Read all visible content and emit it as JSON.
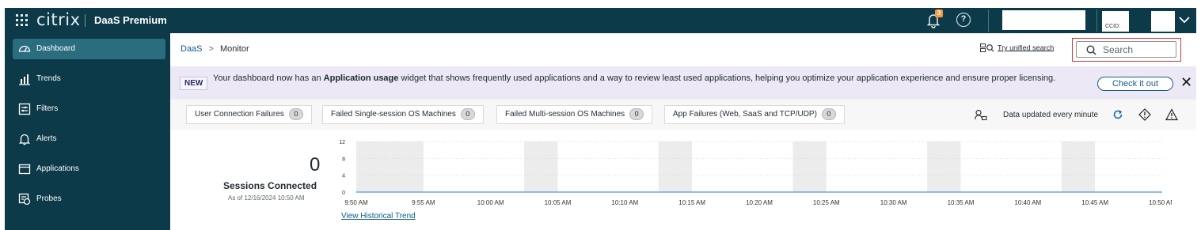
{
  "topbar": {
    "logo": "citrix",
    "product": "DaaS Premium",
    "notification_count": "3",
    "help_label": "?",
    "ccid_label": "CCID:"
  },
  "sidebar": {
    "items": [
      {
        "label": "Dashboard",
        "icon": "dashboard-icon",
        "active": true
      },
      {
        "label": "Trends",
        "icon": "trends-icon",
        "active": false
      },
      {
        "label": "Filters",
        "icon": "filters-icon",
        "active": false
      },
      {
        "label": "Alerts",
        "icon": "bell-icon",
        "active": false
      },
      {
        "label": "Applications",
        "icon": "applications-icon",
        "active": false
      },
      {
        "label": "Probes",
        "icon": "probes-icon",
        "active": false
      }
    ]
  },
  "breadcrumb": {
    "root": "DaaS",
    "separator": ">",
    "current": "Monitor"
  },
  "unified_search": {
    "label": "Try unified search"
  },
  "search": {
    "placeholder": "Search"
  },
  "banner": {
    "tag": "NEW",
    "text_before": "Your dashboard now has an ",
    "text_bold": "Application usage",
    "text_after": " widget that shows frequently used applications and a way to review least used applications, helping you optimize your application experience and ensure proper licensing.",
    "button": "Check it out",
    "close": "✕"
  },
  "chips": [
    {
      "label": "User Connection Failures",
      "count": "0"
    },
    {
      "label": "Failed Single-session OS Machines",
      "count": "0"
    },
    {
      "label": "Failed Multi-session OS Machines",
      "count": "0"
    },
    {
      "label": "App Failures (Web, SaaS and TCP/UDP)",
      "count": "0"
    }
  ],
  "status": {
    "updated": "Data updated every minute"
  },
  "sessions": {
    "count": "0",
    "title": "Sessions Connected",
    "as_of": "As of 12/16/2024 10:50 AM",
    "history_link": "View Historical Trend"
  },
  "chart_data": {
    "type": "area",
    "x": [
      "9:50 AM",
      "9:55 AM",
      "10:00 AM",
      "10:05 AM",
      "10:10 AM",
      "10:15 AM",
      "10:20 AM",
      "10:25 AM",
      "10:30 AM",
      "10:35 AM",
      "10:40 AM",
      "10:45 AM",
      "10:50 AM"
    ],
    "series": [
      {
        "values": [
          0,
          0,
          0,
          0,
          0,
          0,
          0,
          0,
          0,
          0,
          0,
          0,
          0
        ]
      }
    ],
    "yticks": [
      0,
      4,
      8,
      12
    ],
    "ylim": [
      0,
      12
    ],
    "grid": true,
    "line_color": "#6fa8dc",
    "band_color": "#ececec"
  }
}
